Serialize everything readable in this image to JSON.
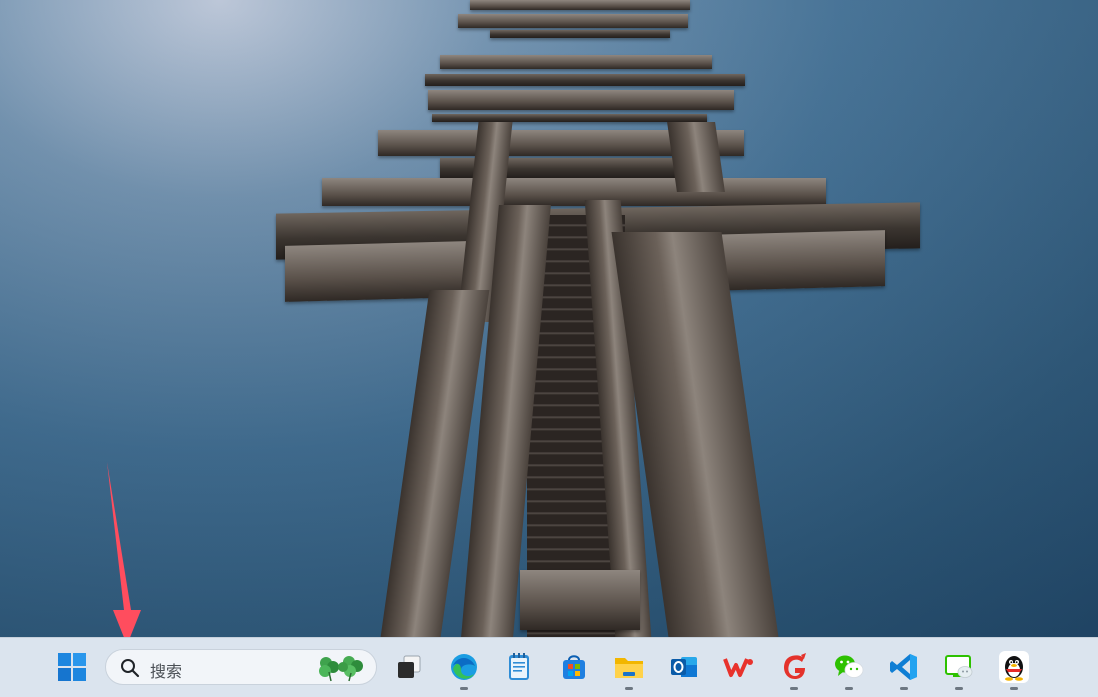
{
  "search": {
    "placeholder": "搜索"
  },
  "taskbar": {
    "apps": [
      {
        "name": "start",
        "icon": "windows-start-icon",
        "running": false
      },
      {
        "name": "task-view",
        "icon": "task-view-icon",
        "running": false
      },
      {
        "name": "edge",
        "icon": "edge-browser-icon",
        "running": true
      },
      {
        "name": "notepad",
        "icon": "notepad-icon",
        "running": false
      },
      {
        "name": "microsoft-store",
        "icon": "store-icon",
        "running": false
      },
      {
        "name": "file-explorer",
        "icon": "folder-icon",
        "running": true
      },
      {
        "name": "outlook",
        "icon": "outlook-icon",
        "running": false
      },
      {
        "name": "wps",
        "icon": "wps-icon",
        "running": false
      },
      {
        "name": "app-red-g",
        "icon": "red-g-icon",
        "running": true
      },
      {
        "name": "wechat",
        "icon": "wechat-icon",
        "running": true
      },
      {
        "name": "vscode",
        "icon": "vscode-icon",
        "running": true
      },
      {
        "name": "wechat-dev-tools",
        "icon": "dev-tools-icon",
        "running": true
      },
      {
        "name": "qq",
        "icon": "qq-penguin-icon",
        "running": true
      }
    ]
  },
  "colors": {
    "taskbar_bg": "#dbe4ee",
    "annotation_arrow": "#ff4d5e"
  }
}
